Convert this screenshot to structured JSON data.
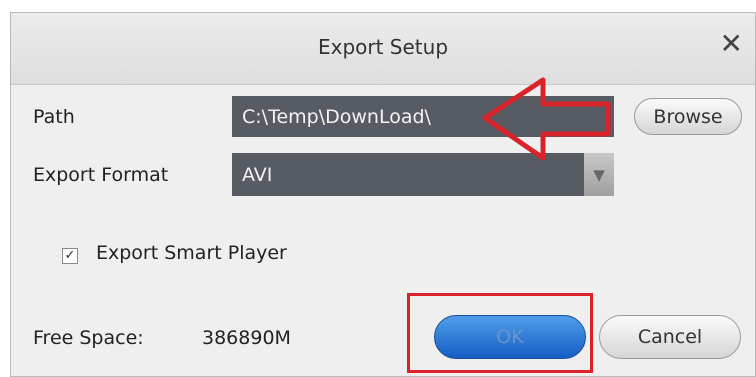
{
  "dialog": {
    "title": "Export Setup",
    "close_glyph": "✕"
  },
  "path": {
    "label": "Path",
    "value": "C:\\Temp\\DownLoad\\",
    "browse_label": "Browse"
  },
  "format": {
    "label": "Export Format",
    "selected": "AVI",
    "arrow_glyph": "▼"
  },
  "smart_player": {
    "label": "Export Smart Player",
    "checked": true,
    "check_glyph": "✓"
  },
  "free_space": {
    "label": "Free Space:",
    "value": "386890M"
  },
  "buttons": {
    "ok": "OK",
    "cancel": "Cancel"
  },
  "annotations": {
    "arrow_color": "#d8232a",
    "box_color": "#d8232a"
  }
}
